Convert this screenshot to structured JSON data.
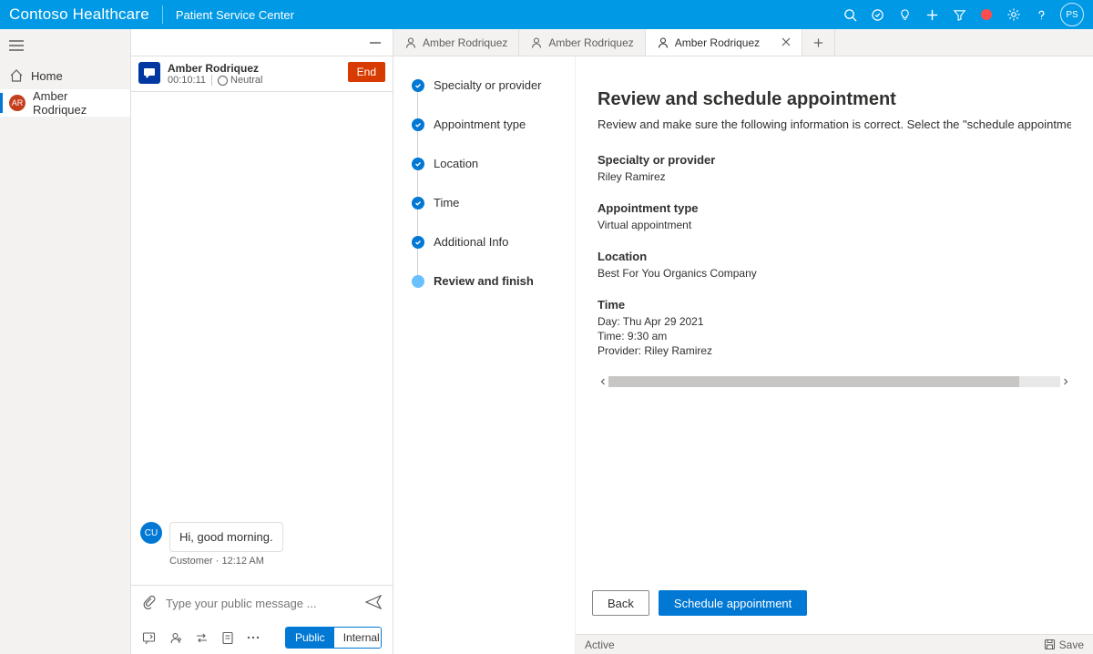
{
  "topbar": {
    "brand": "Contoso Healthcare",
    "subtitle": "Patient Service Center",
    "avatar_initials": "PS"
  },
  "navrail": {
    "home_label": "Home",
    "active_item_label": "Amber Rodriquez",
    "active_item_initials": "AR"
  },
  "conversation": {
    "header": {
      "name": "Amber Rodriquez",
      "timer": "00:10:11",
      "sentiment_label": "Neutral"
    },
    "end_button": "End",
    "message": {
      "avatar_initials": "CU",
      "text": "Hi, good morning.",
      "meta": "Customer · 12:12 AM"
    },
    "compose": {
      "placeholder": "Type your public message ...",
      "public_label": "Public",
      "internal_label": "Internal"
    }
  },
  "tabs": {
    "t1": "Amber Rodriquez",
    "t2": "Amber Rodriquez",
    "t3": "Amber Rodriquez"
  },
  "stepper": {
    "s1": "Specialty or provider",
    "s2": "Appointment type",
    "s3": "Location",
    "s4": "Time",
    "s5": "Additional Info",
    "s6": "Review and finish"
  },
  "review": {
    "title": "Review and schedule appointment",
    "description": "Review and make sure the following information is correct. Select the \"schedule appointment\" button below to book the ap",
    "specialty_label": "Specialty or provider",
    "specialty_value": "Riley Ramirez",
    "appt_type_label": "Appointment type",
    "appt_type_value": "Virtual appointment",
    "location_label": "Location",
    "location_value": "Best For You Organics Company",
    "time_label": "Time",
    "time_day": "Day: Thu Apr 29 2021",
    "time_time": "Time: 9:30 am",
    "time_provider": "Provider: Riley Ramirez",
    "back_button": "Back",
    "schedule_button": "Schedule appointment"
  },
  "statusbar": {
    "status": "Active",
    "save": "Save"
  }
}
